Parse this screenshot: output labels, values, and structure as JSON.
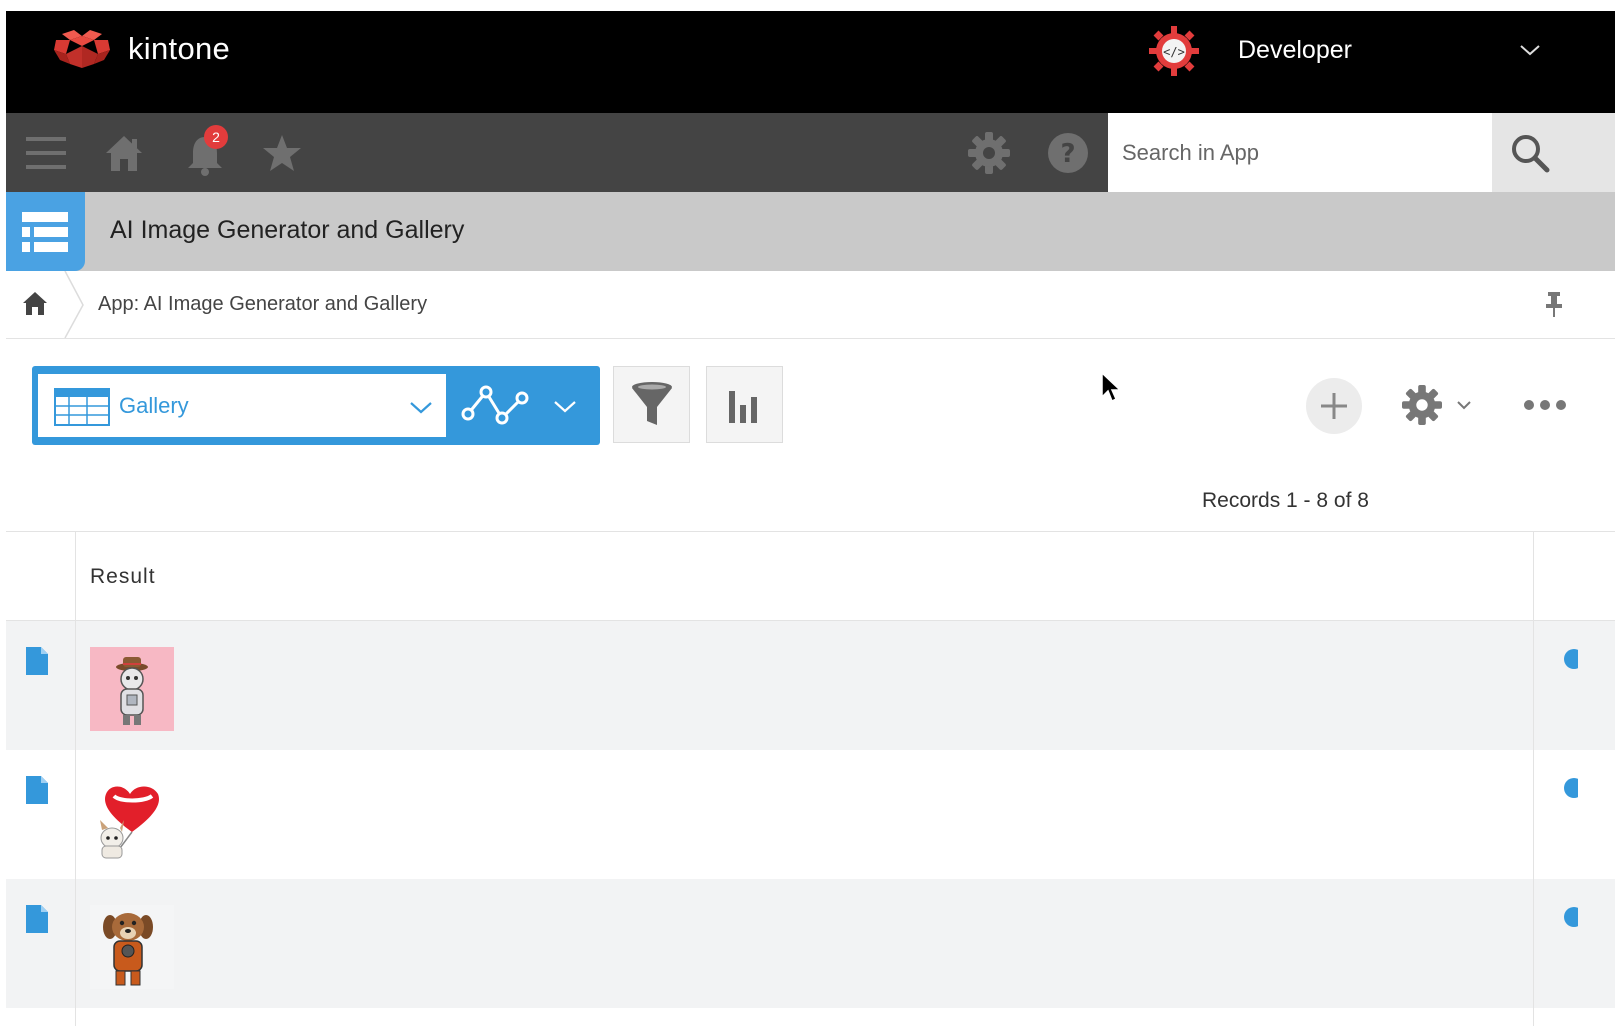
{
  "header": {
    "logo_text": "kintone",
    "user_name": "Developer"
  },
  "toolbar": {
    "notification_count": "2",
    "search_placeholder": "Search in App",
    "icons": [
      "menu-icon",
      "home-icon",
      "bell-icon",
      "star-icon",
      "gear-icon",
      "help-icon",
      "search-icon"
    ]
  },
  "app": {
    "title": "AI Image Generator and Gallery"
  },
  "breadcrumb": {
    "text": "App: AI Image Generator and Gallery"
  },
  "view": {
    "selected": "Gallery"
  },
  "records": {
    "count_text": "Records 1 - 8 of 8"
  },
  "table": {
    "columns": [
      "Result"
    ],
    "rows": [
      {
        "thumbnail": "robot-cat-in-hat-image"
      },
      {
        "thumbnail": "dog-with-heart-balloon-image"
      },
      {
        "thumbnail": "dog-in-armor-image"
      }
    ]
  },
  "colors": {
    "header_bg": "#000000",
    "toolbar_bg": "#444444",
    "app_band_bg": "#c9c9c9",
    "accent_blue": "#3498db",
    "brand_red": "#e23c3c",
    "row_alt_bg": "#f2f3f4"
  }
}
